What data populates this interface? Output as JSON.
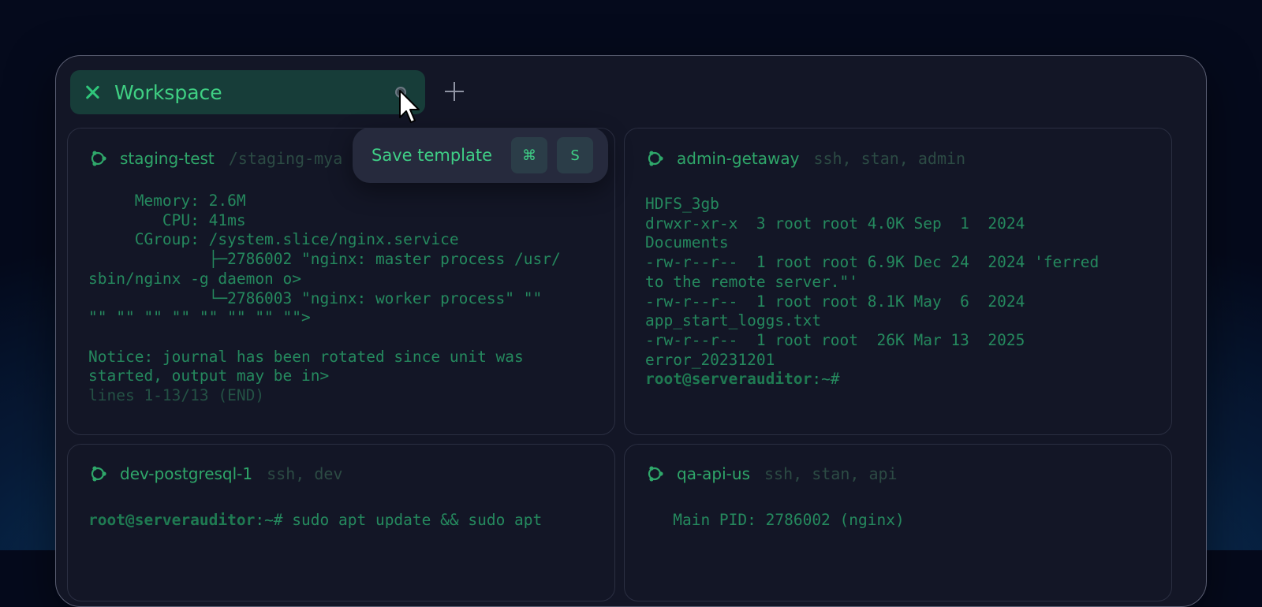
{
  "tab": {
    "title": "Workspace"
  },
  "popover": {
    "label": "Save template",
    "keys": [
      "⌘",
      "S"
    ]
  },
  "panes": [
    {
      "name": "staging-test",
      "tags": "/staging-mya",
      "lines": [
        "     Memory: 2.6M",
        "        CPU: 41ms",
        "     CGroup: /system.slice/nginx.service",
        "             ├─2786002 \"nginx: master process /usr/",
        "sbin/nginx -g daemon o>",
        "             └─2786003 \"nginx: worker process\" \"\"",
        "\"\" \"\" \"\" \"\" \"\" \"\" \"\" \"\">",
        "",
        "Notice: journal has been rotated since unit was",
        "started, output may be in>"
      ],
      "footer": "lines 1-13/13 (END)"
    },
    {
      "name": "admin-getaway",
      "tags": "ssh, stan, admin",
      "lines": [
        "HDFS_3gb",
        "drwxr-xr-x  3 root root 4.0K Sep  1  2024",
        "Documents",
        "-rw-r--r--  1 root root 6.9K Dec 24  2024 'ferred",
        "to the remote server.\"'",
        "-rw-r--r--  1 root root 8.1K May  6  2024",
        "app_start_loggs.txt",
        "-rw-r--r--  1 root root  26K Mar 13  2025",
        "error_20231201"
      ],
      "prompt": "root@serverauditor",
      "prompt_suffix": ":~#"
    },
    {
      "name": "dev-postgresql-1",
      "tags": "ssh, dev",
      "prompt": "root@serverauditor",
      "prompt_suffix": ":~# sudo apt update && sudo apt"
    },
    {
      "name": "qa-api-us",
      "tags": "ssh, stan, api",
      "lines": [
        "   Main PID: 2786002 (nginx)"
      ]
    }
  ]
}
